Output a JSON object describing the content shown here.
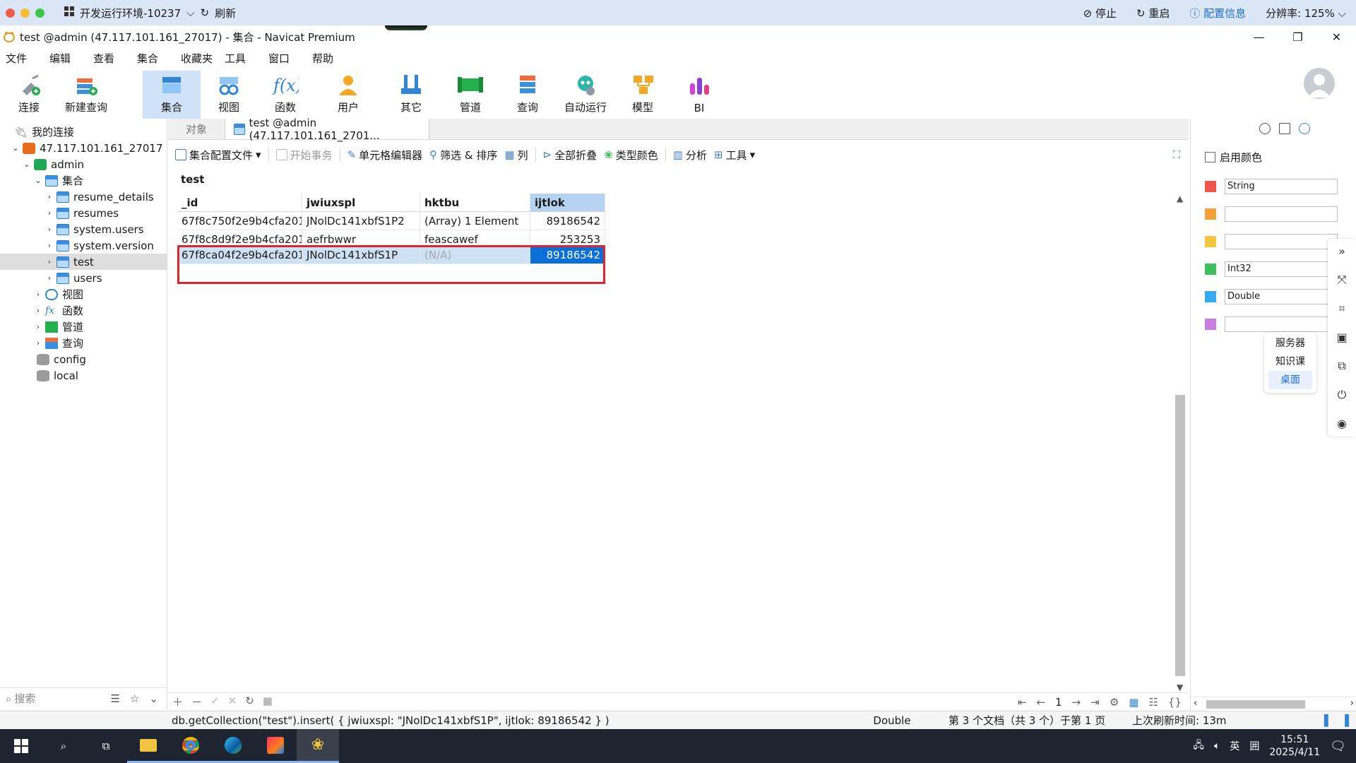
{
  "remote_bar": {
    "env_label": "开发运行环境-10237",
    "refresh_label": "刷新",
    "stop_label": "停止",
    "restart_label": "重启",
    "config_label": "配置信息",
    "resolution_label": "分辨率: 125%"
  },
  "window": {
    "title": "test @admin (47.117.101.161_27017) - 集合 - Navicat Premium"
  },
  "menu": [
    "文件",
    "编辑",
    "查看",
    "集合",
    "收藏夹",
    "工具",
    "窗口",
    "帮助"
  ],
  "toolbar": {
    "items": [
      "连接",
      "新建查询",
      "集合",
      "视图",
      "函数",
      "用户",
      "其它",
      "管道",
      "查询",
      "自动运行",
      "模型",
      "BI"
    ]
  },
  "nav": {
    "root": "我的连接",
    "connection": "47.117.101.161_27017",
    "database": "admin",
    "collections_folder": "集合",
    "collections": [
      "resume_details",
      "resumes",
      "system.users",
      "system.version",
      "test",
      "users"
    ],
    "folders": [
      "视图",
      "函数",
      "管道",
      "查询"
    ],
    "other_dbs": [
      "config",
      "local"
    ],
    "search_placeholder": "搜索"
  },
  "tabs": {
    "objects": "对象",
    "active": "test @admin (47.117.101.161_2701..."
  },
  "subtoolbar": {
    "profile": "集合配置文件",
    "begin_tx": "开始事务",
    "cell_editor": "单元格编辑器",
    "filter_sort": "筛选 & 排序",
    "columns": "列",
    "collapse_all": "全部折叠",
    "type_color": "类型颜色",
    "analyze": "分析",
    "tools": "工具"
  },
  "grid": {
    "collection": "test",
    "columns": [
      "_id",
      "jwiuxspl",
      "hktbu",
      "ijtlok"
    ],
    "rows": [
      [
        "67f8c750f2e9b4cfa201!",
        "JNolDc141xbfS1P2",
        "(Array) 1 Element",
        "89186542"
      ],
      [
        "67f8c8d9f2e9b4cfa201!",
        "aefrbwwr",
        "feascawef",
        "253253"
      ],
      [
        "67f8ca04f2e9b4cfa201!",
        "JNolDc141xbfS1P",
        "(N/A)",
        "89186542"
      ]
    ]
  },
  "record_bar": {
    "page": "1"
  },
  "statusbar": {
    "query": "db.getCollection(\"test\").insert( { jwiuxspl: \"JNolDc141xbfS1P\", ijtlok: 89186542 } )",
    "type": "Double",
    "position": "第 3 个文档（共 3 个）于第 1 页",
    "refresh": "上次刷新时间: 13m"
  },
  "right_panel": {
    "enable_color": "启用颜色",
    "swatches": [
      {
        "color": "#f2554c",
        "label": "String"
      },
      {
        "color": "#f5a03a",
        "label": ""
      },
      {
        "color": "#f5c542",
        "label": ""
      },
      {
        "color": "#3fbf5a",
        "label": "Int32"
      },
      {
        "color": "#39a9f0",
        "label": "Double"
      },
      {
        "color": "#c77ee0",
        "label": ""
      }
    ]
  },
  "float_menu": [
    "服务器",
    "知识课",
    "桌面"
  ],
  "taskbar": {
    "lang": "英",
    "ime": "囲",
    "time": "15:51",
    "date": "2025/4/11"
  }
}
